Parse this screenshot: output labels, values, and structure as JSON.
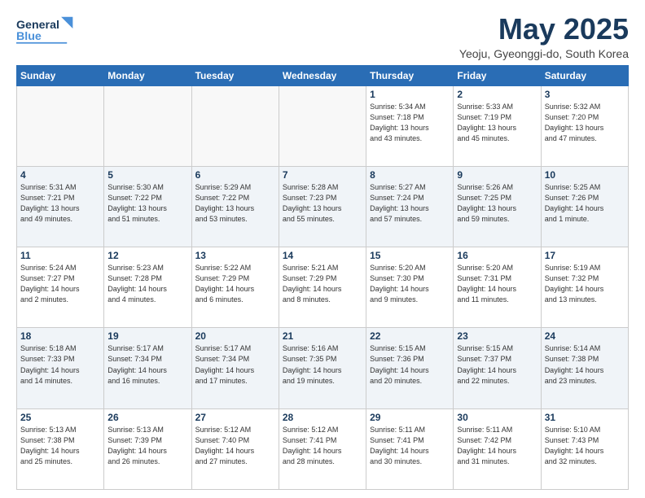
{
  "header": {
    "logo_line1": "General",
    "logo_line2": "Blue",
    "month": "May 2025",
    "location": "Yeoju, Gyeonggi-do, South Korea"
  },
  "weekdays": [
    "Sunday",
    "Monday",
    "Tuesday",
    "Wednesday",
    "Thursday",
    "Friday",
    "Saturday"
  ],
  "weeks": [
    [
      {
        "day": "",
        "info": ""
      },
      {
        "day": "",
        "info": ""
      },
      {
        "day": "",
        "info": ""
      },
      {
        "day": "",
        "info": ""
      },
      {
        "day": "1",
        "info": "Sunrise: 5:34 AM\nSunset: 7:18 PM\nDaylight: 13 hours\nand 43 minutes."
      },
      {
        "day": "2",
        "info": "Sunrise: 5:33 AM\nSunset: 7:19 PM\nDaylight: 13 hours\nand 45 minutes."
      },
      {
        "day": "3",
        "info": "Sunrise: 5:32 AM\nSunset: 7:20 PM\nDaylight: 13 hours\nand 47 minutes."
      }
    ],
    [
      {
        "day": "4",
        "info": "Sunrise: 5:31 AM\nSunset: 7:21 PM\nDaylight: 13 hours\nand 49 minutes."
      },
      {
        "day": "5",
        "info": "Sunrise: 5:30 AM\nSunset: 7:22 PM\nDaylight: 13 hours\nand 51 minutes."
      },
      {
        "day": "6",
        "info": "Sunrise: 5:29 AM\nSunset: 7:22 PM\nDaylight: 13 hours\nand 53 minutes."
      },
      {
        "day": "7",
        "info": "Sunrise: 5:28 AM\nSunset: 7:23 PM\nDaylight: 13 hours\nand 55 minutes."
      },
      {
        "day": "8",
        "info": "Sunrise: 5:27 AM\nSunset: 7:24 PM\nDaylight: 13 hours\nand 57 minutes."
      },
      {
        "day": "9",
        "info": "Sunrise: 5:26 AM\nSunset: 7:25 PM\nDaylight: 13 hours\nand 59 minutes."
      },
      {
        "day": "10",
        "info": "Sunrise: 5:25 AM\nSunset: 7:26 PM\nDaylight: 14 hours\nand 1 minute."
      }
    ],
    [
      {
        "day": "11",
        "info": "Sunrise: 5:24 AM\nSunset: 7:27 PM\nDaylight: 14 hours\nand 2 minutes."
      },
      {
        "day": "12",
        "info": "Sunrise: 5:23 AM\nSunset: 7:28 PM\nDaylight: 14 hours\nand 4 minutes."
      },
      {
        "day": "13",
        "info": "Sunrise: 5:22 AM\nSunset: 7:29 PM\nDaylight: 14 hours\nand 6 minutes."
      },
      {
        "day": "14",
        "info": "Sunrise: 5:21 AM\nSunset: 7:29 PM\nDaylight: 14 hours\nand 8 minutes."
      },
      {
        "day": "15",
        "info": "Sunrise: 5:20 AM\nSunset: 7:30 PM\nDaylight: 14 hours\nand 9 minutes."
      },
      {
        "day": "16",
        "info": "Sunrise: 5:20 AM\nSunset: 7:31 PM\nDaylight: 14 hours\nand 11 minutes."
      },
      {
        "day": "17",
        "info": "Sunrise: 5:19 AM\nSunset: 7:32 PM\nDaylight: 14 hours\nand 13 minutes."
      }
    ],
    [
      {
        "day": "18",
        "info": "Sunrise: 5:18 AM\nSunset: 7:33 PM\nDaylight: 14 hours\nand 14 minutes."
      },
      {
        "day": "19",
        "info": "Sunrise: 5:17 AM\nSunset: 7:34 PM\nDaylight: 14 hours\nand 16 minutes."
      },
      {
        "day": "20",
        "info": "Sunrise: 5:17 AM\nSunset: 7:34 PM\nDaylight: 14 hours\nand 17 minutes."
      },
      {
        "day": "21",
        "info": "Sunrise: 5:16 AM\nSunset: 7:35 PM\nDaylight: 14 hours\nand 19 minutes."
      },
      {
        "day": "22",
        "info": "Sunrise: 5:15 AM\nSunset: 7:36 PM\nDaylight: 14 hours\nand 20 minutes."
      },
      {
        "day": "23",
        "info": "Sunrise: 5:15 AM\nSunset: 7:37 PM\nDaylight: 14 hours\nand 22 minutes."
      },
      {
        "day": "24",
        "info": "Sunrise: 5:14 AM\nSunset: 7:38 PM\nDaylight: 14 hours\nand 23 minutes."
      }
    ],
    [
      {
        "day": "25",
        "info": "Sunrise: 5:13 AM\nSunset: 7:38 PM\nDaylight: 14 hours\nand 25 minutes."
      },
      {
        "day": "26",
        "info": "Sunrise: 5:13 AM\nSunset: 7:39 PM\nDaylight: 14 hours\nand 26 minutes."
      },
      {
        "day": "27",
        "info": "Sunrise: 5:12 AM\nSunset: 7:40 PM\nDaylight: 14 hours\nand 27 minutes."
      },
      {
        "day": "28",
        "info": "Sunrise: 5:12 AM\nSunset: 7:41 PM\nDaylight: 14 hours\nand 28 minutes."
      },
      {
        "day": "29",
        "info": "Sunrise: 5:11 AM\nSunset: 7:41 PM\nDaylight: 14 hours\nand 30 minutes."
      },
      {
        "day": "30",
        "info": "Sunrise: 5:11 AM\nSunset: 7:42 PM\nDaylight: 14 hours\nand 31 minutes."
      },
      {
        "day": "31",
        "info": "Sunrise: 5:10 AM\nSunset: 7:43 PM\nDaylight: 14 hours\nand 32 minutes."
      }
    ]
  ]
}
